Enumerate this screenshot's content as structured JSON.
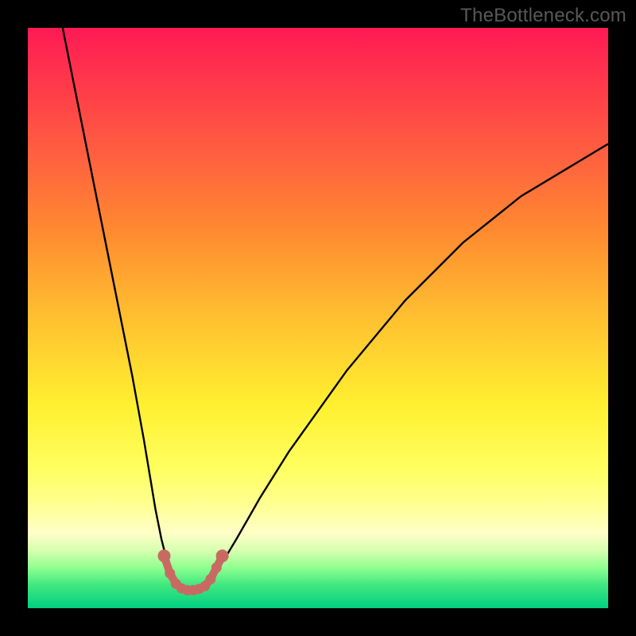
{
  "watermark": "TheBottleneck.com",
  "colors": {
    "frame": "#000000",
    "gradient_top": "#ff1a55",
    "gradient_bottom": "#00d080",
    "curve": "#000000",
    "bead": "#c96a62",
    "watermark_text": "#585858"
  },
  "chart_data": {
    "type": "line",
    "title": "",
    "xlabel": "",
    "ylabel": "",
    "xlim": [
      0,
      100
    ],
    "ylim": [
      0,
      100
    ],
    "grid": false,
    "legend": false,
    "series": [
      {
        "name": "left-branch",
        "x": [
          6,
          8,
          10,
          12,
          14,
          16,
          18,
          20,
          21,
          22,
          23,
          24,
          25,
          26
        ],
        "y": [
          100,
          90,
          80,
          70,
          60,
          50,
          40,
          29,
          23,
          17,
          12,
          8,
          5,
          4
        ]
      },
      {
        "name": "right-branch",
        "x": [
          31,
          33,
          36,
          40,
          45,
          50,
          55,
          60,
          65,
          70,
          75,
          80,
          85,
          90,
          95,
          100
        ],
        "y": [
          4,
          7,
          12,
          19,
          27,
          34,
          41,
          47,
          53,
          58,
          63,
          67,
          71,
          74,
          77,
          80
        ]
      },
      {
        "name": "bead-trough",
        "x": [
          23.5,
          24.5,
          25.5,
          26.5,
          27.5,
          28.5,
          29.5,
          30.5,
          31.5,
          32.5,
          33.5
        ],
        "y": [
          9,
          6,
          4.2,
          3.4,
          3.1,
          3.1,
          3.3,
          3.8,
          5,
          7,
          9
        ]
      }
    ],
    "annotations": []
  }
}
